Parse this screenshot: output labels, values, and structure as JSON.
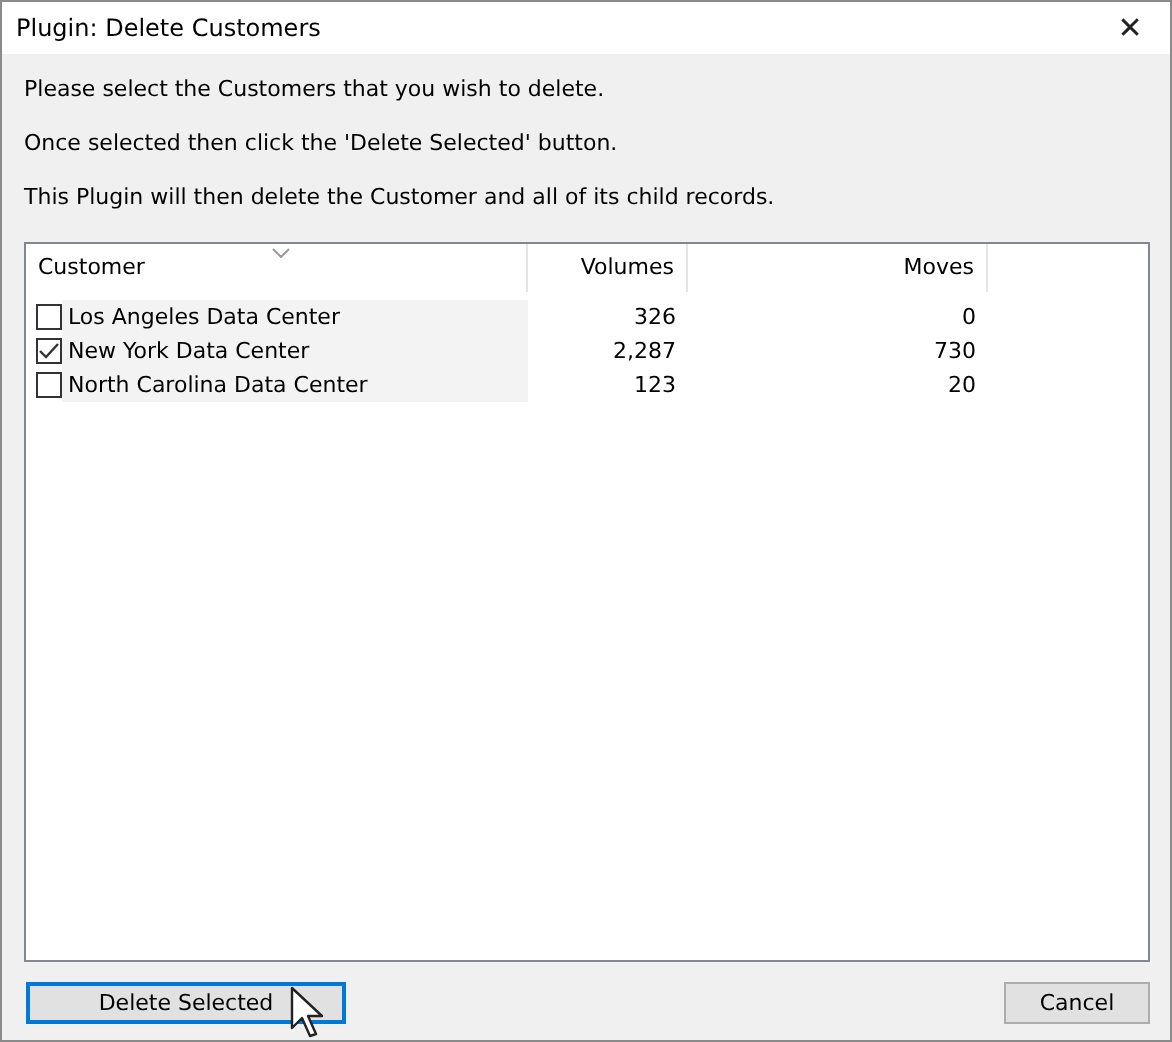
{
  "window": {
    "title": "Plugin: Delete Customers",
    "close": "✕"
  },
  "instructions": [
    "Please select the Customers that you wish to delete.",
    "Once selected then click the 'Delete Selected' button.",
    "This Plugin will then delete the Customer and all of its child records."
  ],
  "table": {
    "columns": [
      "Customer",
      "Volumes",
      "Moves"
    ],
    "rows": [
      {
        "cells": [
          "Los Angeles Data Center",
          "326",
          "0"
        ],
        "checked": false
      },
      {
        "cells": [
          "New York Data Center",
          "2,287",
          "730"
        ],
        "checked": true
      },
      {
        "cells": [
          "North Carolina Data Center",
          "123",
          "20"
        ],
        "checked": false
      }
    ]
  },
  "buttons": [
    {
      "label": "Delete Selected",
      "focused": true
    },
    {
      "label": "Cancel",
      "focused": false
    }
  ]
}
